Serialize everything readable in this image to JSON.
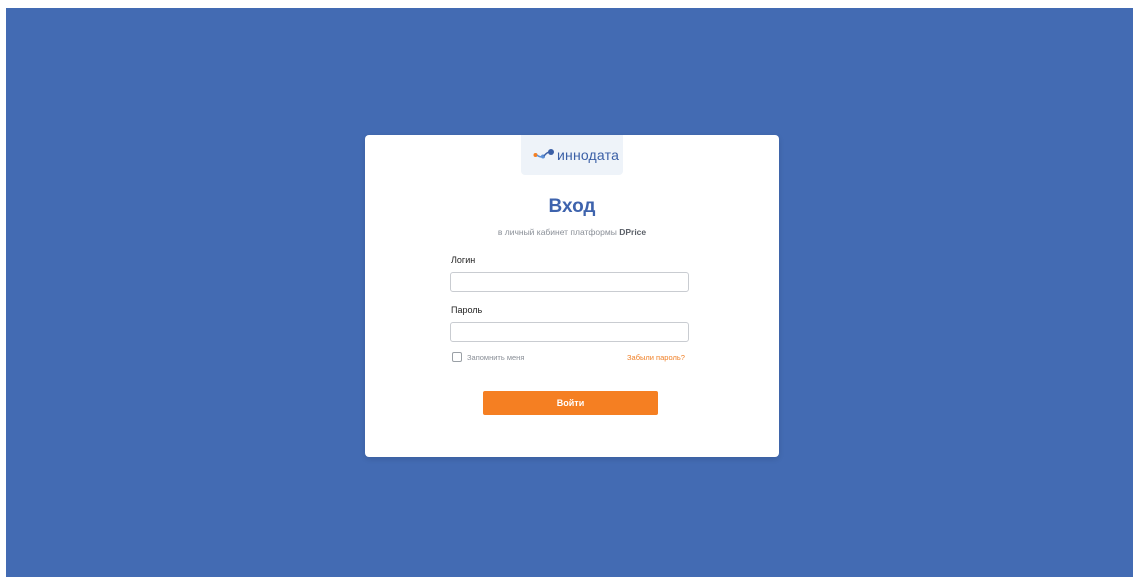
{
  "colors": {
    "background": "#436bb3",
    "brand_blue": "#3e63ad",
    "accent_orange": "#f57f22"
  },
  "logo": {
    "text": "иннодата",
    "icon": "innodata-logo-icon"
  },
  "login": {
    "title": "Вход",
    "subtitle_prefix": "в личный кабинет платформы ",
    "subtitle_brand": "DPrice"
  },
  "form": {
    "login_label": "Логин",
    "login_value": "",
    "password_label": "Пароль",
    "password_value": "",
    "remember_label": "Запомнить меня",
    "remember_checked": false,
    "forgot_link": "Забыли пароль?",
    "submit_label": "Войти"
  }
}
